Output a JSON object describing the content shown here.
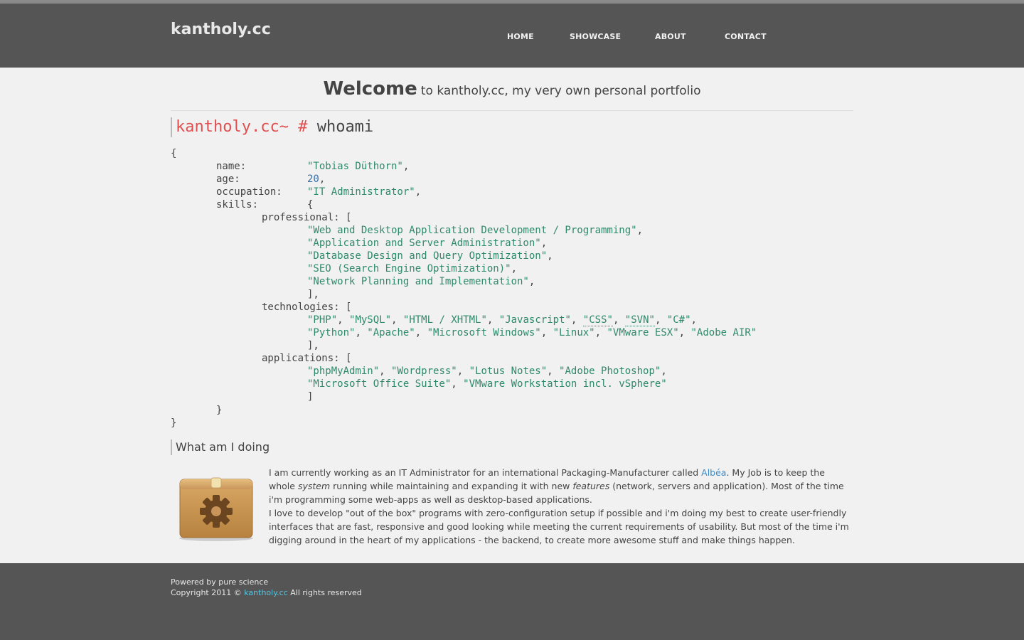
{
  "header": {
    "logo": "kantholy.cc",
    "nav": [
      "HOME",
      "SHOWCASE",
      "ABOUT",
      "CONTACT"
    ]
  },
  "welcome": {
    "bold": "Welcome",
    "rest": "to kantholy.cc, my very own personal portfolio"
  },
  "terminal": {
    "host": "kantholy.cc~",
    "hash": "#",
    "command": "whoami"
  },
  "profile": {
    "name_key": "name:",
    "name": "\"Tobias Düthorn\"",
    "age_key": "age:",
    "age": "20",
    "occupation_key": "occupation:",
    "occupation": "\"IT Administrator\"",
    "skills_key": "skills:",
    "professional_key": "professional:",
    "professional": [
      "\"Web and Desktop Application Development / Programming\"",
      "\"Application and Server Administration\"",
      "\"Database Design and Query Optimization\"",
      "\"SEO (Search Engine Optimization)\"",
      "\"Network Planning and Implementation\""
    ],
    "technologies_key": "technologies:",
    "technologies": [
      "\"PHP\"",
      "\"MySQL\"",
      "\"HTML / XHTML\"",
      "\"Javascript\"",
      "\"CSS\"",
      "\"SVN\"",
      "\"C#\"",
      "\"Python\"",
      "\"Apache\"",
      "\"Microsoft Windows\"",
      "\"Linux\"",
      "\"VMware ESX\"",
      "\"Adobe AIR\""
    ],
    "applications_key": "applications:",
    "applications": [
      "\"phpMyAdmin\"",
      "\"Wordpress\"",
      "\"Lotus Notes\"",
      "\"Adobe Photoshop\"",
      "\"Microsoft Office Suite\"",
      "\"VMware Workstation incl. vSphere\""
    ]
  },
  "doing": {
    "title": "What am I doing",
    "icon": "package-gear-icon",
    "p1_a": "I am currently working as an IT Administrator for an international Packaging-Manufacturer called ",
    "p1_link": "Albéa",
    "p1_b": ". My Job is to keep the whole ",
    "p1_em1": "system",
    "p1_c": " running while maintaining and expanding it with new ",
    "p1_em2": "features",
    "p1_d": " (network, servers and application). Most of the time i'm programming some web-apps as well as desktop-based applications.",
    "p2": "I love to develop \"out of the box\" programs with zero-configuration setup if possible and i'm doing my best to create user-friendly interfaces that are fast, responsive and good looking while meeting the current requirements of usability. But most of the time i'm digging around in the heart of my applications - the backend, to create more awesome stuff and make things happen."
  },
  "footer": {
    "line1": "Powered by pure science",
    "copy": "Copyright 2011 ©",
    "link": "kantholy.cc",
    "rights": "All rights reserved"
  },
  "colors": {
    "header_bg": "#555555",
    "page_bg": "#f1f1f1",
    "prompt": "#e05050",
    "string": "#2e8a6a",
    "number": "#3a6ea5",
    "link": "#3a8ac7",
    "footer_link": "#56c6e0"
  }
}
